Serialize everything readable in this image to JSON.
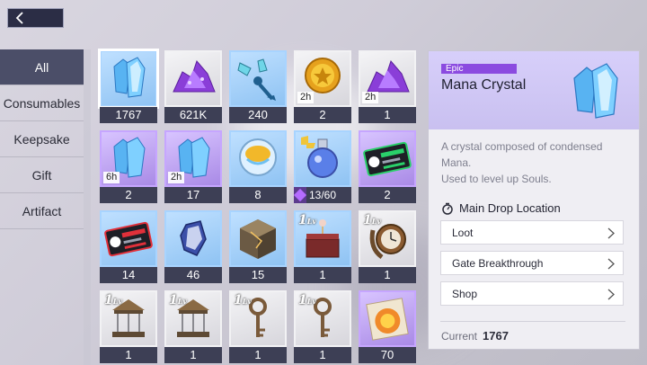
{
  "sidebar": {
    "items": [
      {
        "label": "All",
        "active": true
      },
      {
        "label": "Consumables",
        "active": false
      },
      {
        "label": "Keepsake",
        "active": false
      },
      {
        "label": "Gift",
        "active": false
      },
      {
        "label": "Artifact",
        "active": false
      }
    ]
  },
  "grid": {
    "items": [
      {
        "name": "mana-crystal",
        "count": "1767",
        "rarity": "rare",
        "selected": true
      },
      {
        "name": "purple-ore",
        "count": "621K",
        "rarity": "common"
      },
      {
        "name": "crystal-key",
        "count": "240",
        "rarity": "rare"
      },
      {
        "name": "gold-coin",
        "count": "2",
        "rarity": "common",
        "time": "2h"
      },
      {
        "name": "purple-ore-timed",
        "count": "1",
        "rarity": "common",
        "time": "2h"
      },
      {
        "name": "mana-crystal-timed",
        "count": "2",
        "rarity": "epic",
        "time": "6h"
      },
      {
        "name": "mana-crystal-timed-2",
        "count": "17",
        "rarity": "epic",
        "time": "2h"
      },
      {
        "name": "golden-orb",
        "count": "8",
        "rarity": "rare"
      },
      {
        "name": "potion-flask",
        "progress_text": "13/60",
        "progress_value": 0.2167,
        "rarity": "rare"
      },
      {
        "name": "ticket-green",
        "count": "2",
        "rarity": "epic"
      },
      {
        "name": "ticket-red",
        "count": "14",
        "rarity": "rare"
      },
      {
        "name": "blue-gem",
        "count": "46",
        "rarity": "rare"
      },
      {
        "name": "stone-cube",
        "count": "15",
        "rarity": "rare"
      },
      {
        "name": "music-box",
        "count": "1",
        "rarity": "rare",
        "level": "1"
      },
      {
        "name": "pocket-watch",
        "count": "1",
        "rarity": "common",
        "level": "1"
      },
      {
        "name": "carousel-1",
        "count": "1",
        "rarity": "common",
        "level": "1"
      },
      {
        "name": "carousel-2",
        "count": "1",
        "rarity": "common",
        "level": "1"
      },
      {
        "name": "antique-key-1",
        "count": "1",
        "rarity": "common",
        "level": "1"
      },
      {
        "name": "antique-key-2",
        "count": "1",
        "rarity": "common",
        "level": "1"
      },
      {
        "name": "fire-scroll",
        "count": "70",
        "rarity": "epic"
      }
    ],
    "level_suffix": "Lv"
  },
  "detail": {
    "rarity": "Epic",
    "name": "Mana Crystal",
    "description_line1": "A crystal composed of condensed",
    "description_line2": "Mana.",
    "description_line3": "Used to level up Souls.",
    "drop_heading": "Main Drop Location",
    "drops": [
      "Loot",
      "Gate Breakthrough",
      "Shop"
    ],
    "current_label": "Current",
    "current_value": "1767"
  },
  "colors": {
    "epic": "#8b4be0",
    "rare": "#8fc3f3",
    "count_bar": "#3d3f55",
    "sidebar_active": "#4b4e68"
  }
}
